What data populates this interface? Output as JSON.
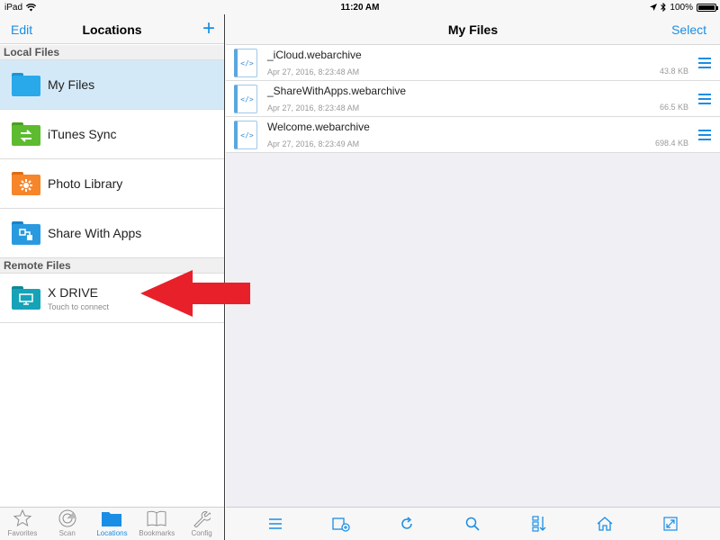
{
  "status_bar": {
    "device": "iPad",
    "time": "11:20 AM",
    "battery": "100%"
  },
  "left_nav": {
    "edit_label": "Edit",
    "title": "Locations",
    "add_label": "+"
  },
  "local_files": {
    "header": "Local Files",
    "items": [
      {
        "label": "My Files",
        "color": "#29a9ea"
      },
      {
        "label": "iTunes Sync",
        "color": "#5dbb2f"
      },
      {
        "label": "Photo Library",
        "color": "#f7852a"
      },
      {
        "label": "Share With Apps",
        "color": "#2a9ae0"
      }
    ]
  },
  "remote_files": {
    "header": "Remote Files",
    "items": [
      {
        "label": "X DRIVE",
        "subtitle": "Touch to connect",
        "color": "#16a3b8"
      }
    ]
  },
  "tabbar": {
    "items": [
      {
        "label": "Favorites"
      },
      {
        "label": "Scan"
      },
      {
        "label": "Locations"
      },
      {
        "label": "Bookmarks"
      },
      {
        "label": "Config"
      }
    ]
  },
  "right_nav": {
    "title": "My Files",
    "select_label": "Select"
  },
  "files": [
    {
      "name": "_iCloud.webarchive",
      "date": "Apr 27, 2016, 8:23:48 AM",
      "size": "43.8 KB"
    },
    {
      "name": "_ShareWithApps.webarchive",
      "date": "Apr 27, 2016, 8:23:48 AM",
      "size": "66.5 KB"
    },
    {
      "name": "Welcome.webarchive",
      "date": "Apr 27, 2016, 8:23:49 AM",
      "size": "698.4 KB"
    }
  ],
  "file_icon_text": "</>",
  "accent_color": "#1a8ee5",
  "arrow_color": "#e8202a"
}
